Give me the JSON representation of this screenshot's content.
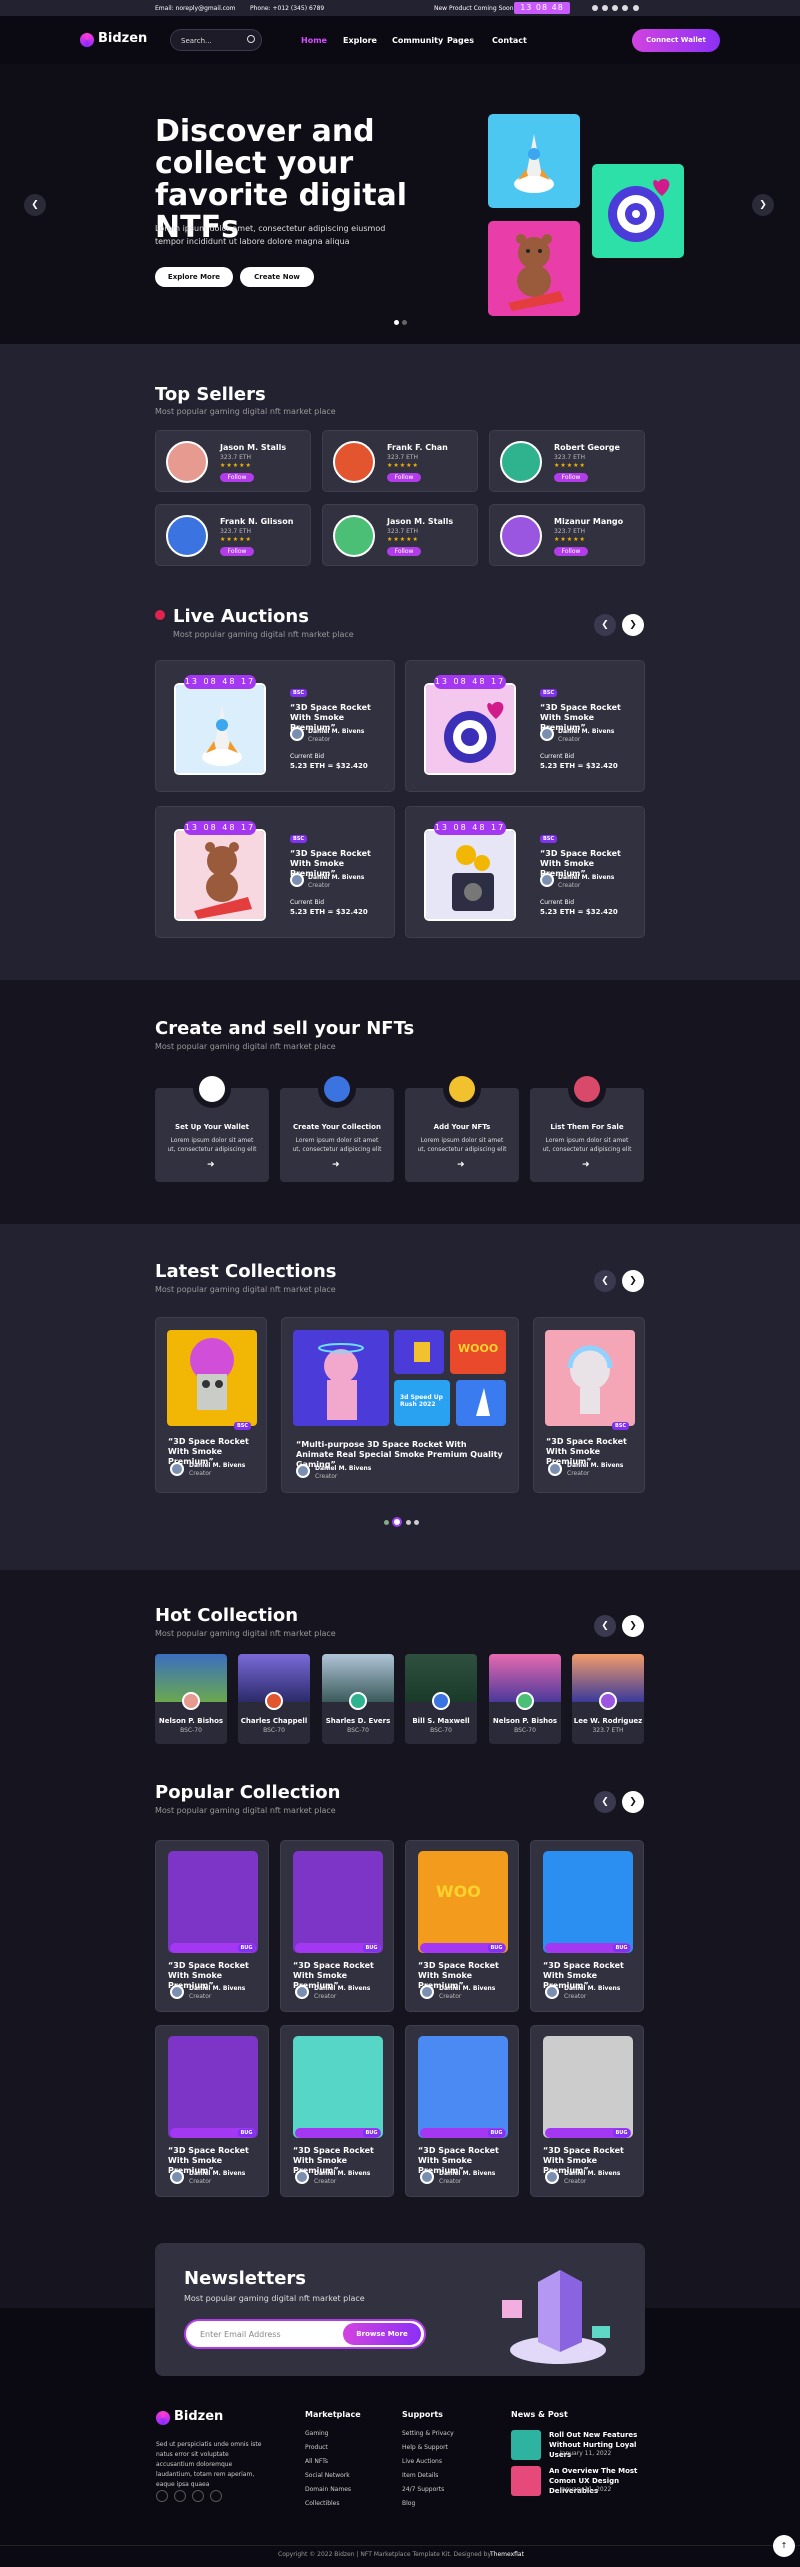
{
  "topbar": {
    "email": "Email: noreply@gmail.com",
    "phone": "Phone: +012 (345) 6789",
    "notice": "New Product Coming Soon:",
    "timer": "13 08 48 18"
  },
  "header": {
    "logo": "Bidzen",
    "search_placeholder": "Search...",
    "nav": [
      "Home",
      "Explore",
      "Community",
      "Pages",
      "Contact"
    ],
    "connect": "Connect Wallet"
  },
  "hero": {
    "title": "Discover and collect your favorite digital NTFs",
    "text": "Lorem ipsum dolor amet, consectetur adipiscing eiusmod tempor incididunt ut labore dolore magna aliqua",
    "btn1": "Explore More",
    "btn2": "Create Now"
  },
  "top_sellers": {
    "title": "Top Sellers",
    "subtitle": "Most popular gaming digital nft market place",
    "follow": "Follow",
    "eth": "323.7 ETH",
    "stars": "★★★★★",
    "items": [
      "Jason M. Stalls",
      "Frank F. Chan",
      "Robert George",
      "Frank N. Glisson",
      "Jason M. Stalls",
      "Mizanur Mango"
    ]
  },
  "live": {
    "title": "Live Auctions",
    "subtitle": "Most popular gaming digital nft market place",
    "timer": "13 08 48 17",
    "badge": "BSC",
    "name": "“3D Space Rocket With Smoke Premium”",
    "creator": "Daniel M. Bivens",
    "role": "Creator",
    "bid_label": "Current Bid",
    "bid": "5.23 ETH = $32.420"
  },
  "create": {
    "title": "Create and sell your NFTs",
    "subtitle": "Most popular gaming digital nft market place",
    "steps": [
      "Set Up Your Wallet",
      "Create Your Collection",
      "Add Your NFTs",
      "List Them For Sale"
    ],
    "text": "Lorem ipsum dolor sit amet ut, consectetur adipiscing elit"
  },
  "latest": {
    "title": "Latest Collections",
    "subtitle": "Most popular gaming digital nft market place",
    "name": "“3D Space Rocket With Smoke Premium”",
    "big_name": "“Multi-purpose 3D Space Rocket With Animate Real Special Smoke Premium Quality Gaming”",
    "creator": "Daniel M. Bivens",
    "role": "Creator",
    "badge": "BSC",
    "speed": "3d Speed Up Rush 2022",
    "wooo": "WOOO"
  },
  "hot": {
    "title": "Hot Collection",
    "subtitle": "Most popular gaming digital nft market place",
    "val": "BSC-70",
    "val2": "323.7 ETH",
    "items": [
      "Nelson P. Bishos",
      "Charles Chappell",
      "Sharles D. Evers",
      "Bill S. Maxwell",
      "Nelson P. Bishos",
      "Lee W. Rodriguez"
    ]
  },
  "popular": {
    "title": "Popular Collection",
    "subtitle": "Most popular gaming digital nft market place",
    "name": "“3D Space Rocket With Smoke Premium”",
    "creator": "Daniel M. Bivens",
    "role": "Creator",
    "badge": "BUG",
    "woo": "WOO"
  },
  "newsletter": {
    "title": "Newsletters",
    "subtitle": "Most popular gaming digital nft market place",
    "placeholder": "Enter Email Address",
    "button": "Browse More"
  },
  "footer": {
    "logo": "Bidzen",
    "about": "Sed ut perspiciatis unde omnis iste natus error sit voluptate accusantium doloremque laudantium, totam rem aperiam, eaque ipsa quaea",
    "marketplace_title": "Marketplace",
    "marketplace": [
      "Gaming",
      "Product",
      "All NFTs",
      "Social Network",
      "Domain Names",
      "Collectibles"
    ],
    "supports_title": "Supports",
    "supports": [
      "Setting & Privacy",
      "Help & Support",
      "Live Auctions",
      "Item Details",
      "24/7 Supports",
      "Blog"
    ],
    "news_title": "News & Post",
    "news": [
      {
        "title": "Roll Out New Features Without Hurting Loyal Users",
        "date": "January 11, 2022"
      },
      {
        "title": "An Overview The Most Comon UX Design Deliverables",
        "date": "January 11, 2022"
      }
    ],
    "copyright": "Copyright © 2022 Bidzen | NFT Marketplace Template Kit. Designed by",
    "designer": "Themexflat"
  },
  "colors": {
    "accent": "#b33cea",
    "bg": "#16151f",
    "panel": "#232231"
  }
}
